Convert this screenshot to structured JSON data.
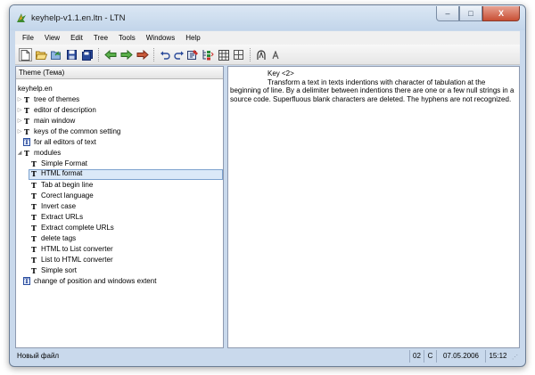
{
  "window": {
    "title": "keyhelp-v1.1.en.ltn - LTN",
    "caption_buttons": {
      "minimize": "–",
      "maximize": "□",
      "close": "X"
    }
  },
  "menubar": {
    "items": [
      "File",
      "View",
      "Edit",
      "Tree",
      "Tools",
      "Windows",
      "Help"
    ]
  },
  "toolbar": {
    "buttons": [
      "new-file-icon",
      "open-folder-icon",
      "open-recent-icon",
      "save-icon",
      "save-all-icon",
      "back-icon",
      "forward-icon",
      "jump-icon",
      "undo-icon",
      "redo-icon",
      "tree-edit-icon",
      "tree-move-icon",
      "table-icon",
      "grid-icon",
      "bookmark-icon",
      "marker-icon"
    ]
  },
  "tree_pane": {
    "header": "Theme (Тема)",
    "root": "keyhelp.en",
    "items": [
      {
        "label": "tree of themes"
      },
      {
        "label": "editor of description"
      },
      {
        "label": "main window"
      },
      {
        "label": "keys of the common setting"
      },
      {
        "label": "for all editors of text"
      },
      {
        "label": "modules"
      },
      {
        "label": "Simple Format"
      },
      {
        "label": "HTML format"
      },
      {
        "label": "Tab at begin line"
      },
      {
        "label": "Corect language"
      },
      {
        "label": "Invert case"
      },
      {
        "label": "Extract URLs"
      },
      {
        "label": "Extract complete URLs"
      },
      {
        "label": "delete tags"
      },
      {
        "label": "HTML to List converter"
      },
      {
        "label": "List to HTML converter"
      },
      {
        "label": "Simple sort"
      },
      {
        "label": "change of position and windows extent"
      }
    ],
    "expand_collapsed": "▷",
    "expand_open": "◢",
    "theme_glyph": "T"
  },
  "description": {
    "key": "Key <2>",
    "text": "Transform a text in texts indentions with character of tabulation at the beginning of line. By a delimiter between indentions there are one or a few null strings in a source code. Superfluous blank characters are deleted. The hyphens are not recognized."
  },
  "statusbar": {
    "file_state": "Новый файл",
    "position": "02",
    "mode": "C",
    "date": "07.05.2006",
    "time": "15:12"
  },
  "colors": {
    "titlebar": "#c9d9ec",
    "selection": "#dbe9f8",
    "selection_border": "#7da2ce",
    "close_button": "#c84f34"
  }
}
